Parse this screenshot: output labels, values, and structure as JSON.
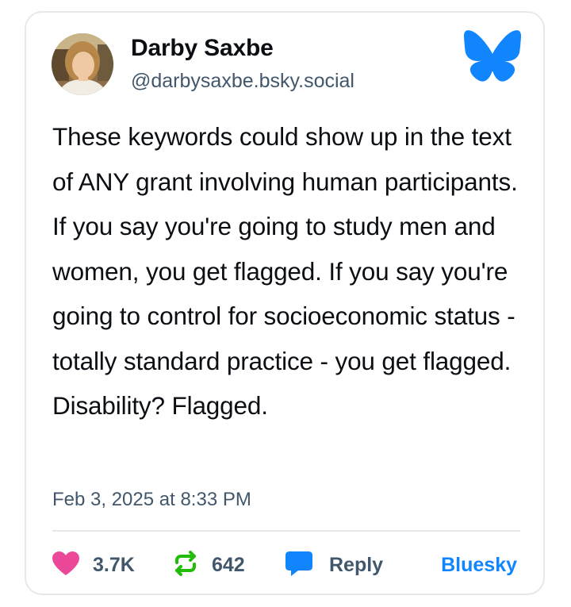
{
  "author": {
    "name": "Darby Saxbe",
    "handle": "@darbysaxbe.bsky.social",
    "avatar_icon": "profile-photo"
  },
  "post": {
    "text": "These keywords could show up in the text of ANY grant involving human participants. If you say you're going to study men and women, you get flagged. If you say you're going to control for socioeconomic status - totally standard practice - you get flagged. Disability? Flagged.",
    "timestamp": "Feb 3, 2025 at 8:33 PM"
  },
  "actions": {
    "likes": "3.7K",
    "reposts": "642",
    "reply_label": "Reply",
    "platform_link": "Bluesky"
  },
  "icons": {
    "logo": "bluesky-butterfly-icon",
    "like": "heart-icon",
    "repost": "repost-icon",
    "reply": "speech-bubble-icon"
  },
  "colors": {
    "brand": "#1185fe",
    "like": "#ec4899",
    "repost": "#20bc07",
    "reply": "#1185fe",
    "muted_text": "#42576c",
    "body_text": "#0b0f14",
    "border": "#e6e8ec"
  }
}
